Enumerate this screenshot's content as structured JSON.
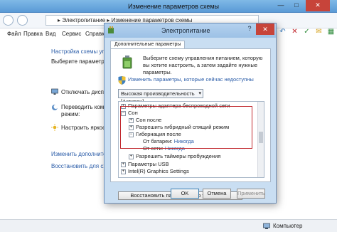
{
  "window": {
    "title": "Изменение параметров схемы",
    "controls": {
      "minimize": "—",
      "maximize": "□",
      "close": "✕"
    }
  },
  "address": {
    "path": "▸ Электропитание ▸ Изменение параметров схемы"
  },
  "menu": [
    "Файл",
    "Правка",
    "Вид",
    "Сервис",
    "Справка"
  ],
  "background": {
    "heading": "Настройка схемы управ",
    "subheading": "Выберите параметры с",
    "rows": [
      "Отключать диспле",
      "Переводить компь",
      "режим:",
      "Настроить яркость"
    ],
    "links": [
      "Изменить дополнител",
      "Восстановить для схе"
    ]
  },
  "status": {
    "computer": "Компьютер"
  },
  "dialog": {
    "title": "Электропитание",
    "help": "?",
    "close": "✕",
    "tab": "Дополнительные параметры",
    "description": "Выберите схему управления питанием, которую вы хотите настроить, а затем задайте нужные параметры.",
    "change_link": "Изменить параметры, которые сейчас недоступны",
    "plan_select": "Высокая производительность [Активен]",
    "tree": [
      {
        "label": "Параметры адаптера беспроводной сети",
        "exp": "+",
        "indent": 0
      },
      {
        "label": "Сон",
        "exp": "−",
        "indent": 0
      },
      {
        "label": "Сон после",
        "exp": "+",
        "indent": 1
      },
      {
        "label": "Разрешить гибридный спящий режим",
        "exp": "+",
        "indent": 1
      },
      {
        "label": "Гибернация после",
        "exp": "−",
        "indent": 1
      },
      {
        "label": "От батареи:",
        "value": "Никогда",
        "indent": 2
      },
      {
        "label": "От сети:",
        "value": "Никогда",
        "indent": 2
      },
      {
        "label": "Разрешить таймеры пробуждения",
        "exp": "+",
        "indent": 1
      },
      {
        "label": "Параметры USB",
        "exp": "+",
        "indent": 0
      },
      {
        "label": "Intel(R) Graphics Settings",
        "exp": "+",
        "indent": 0
      }
    ],
    "restore_button": "Восстановить параметры по умолчанию",
    "buttons": {
      "ok": "OK",
      "cancel": "Отмена",
      "apply": "Применить"
    }
  }
}
